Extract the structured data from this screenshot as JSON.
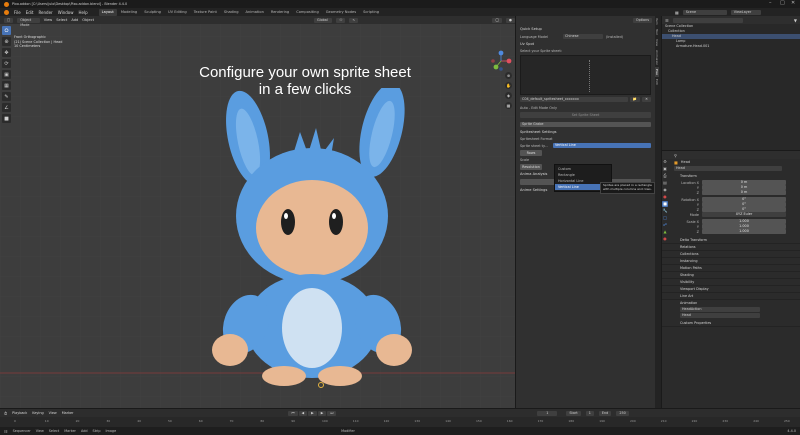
{
  "window": {
    "title": "Pixo.addon [C:\\Users\\julo\\Desktop\\Pixo.addon.blend] - Blender 4.4.0",
    "controls": [
      "–",
      "□",
      "✕"
    ]
  },
  "menubar": {
    "items": [
      "File",
      "Edit",
      "Render",
      "Window",
      "Help"
    ],
    "workspaces": [
      "Layout",
      "Modeling",
      "Sculpting",
      "UV Editing",
      "Texture Paint",
      "Shading",
      "Animation",
      "Rendering",
      "Compositing",
      "Geometry Nodes",
      "Scripting"
    ],
    "active_workspace": "Layout",
    "scene_label": "Scene",
    "view_layer_label": "ViewLayer"
  },
  "viewport": {
    "mode": "Object Mode",
    "menus": [
      "View",
      "Select",
      "Add",
      "Object"
    ],
    "transform": "Global",
    "options_label": "Options",
    "overlay_lines": [
      "Front Orthographic",
      "(21) Scene Collection | Head",
      "10 Centimeters"
    ],
    "headline_line1": "Configure your own sprite sheet",
    "headline_line2": "in a few clicks",
    "gizmo_axes": [
      "X",
      "Y",
      "Z"
    ]
  },
  "npanel": {
    "quick_setup": "Quick Setup",
    "language_model_label": "Language Model",
    "language_model_value": "Chinese",
    "installed_label": "(Installed)",
    "uv_spot": "Uv Spot",
    "select_sprite_sheet": "Select your Sprite sheet:",
    "file_name": "C04_default_spritesheet_xxxxxxx",
    "auto_edit_label": "Auto - Edit Mode Only",
    "set_button": "Set Sprite Sheet",
    "sprite_dropdown": "Sprite Grabe",
    "spritesheet_settings": "Spritesheet Settings",
    "spritesheet_format": "Spritesheet Format",
    "sprite_sheet_ty_label": "Sprite sheet ty...",
    "sprite_sheet_ty_value": "Vertical Line",
    "rows_label": "Rows",
    "scale_label": "Scale",
    "resolution_label": "Resolution",
    "count_label": "Count",
    "dropdown_options": [
      "Custom",
      "Rectangle",
      "Horizontal Line",
      "Vertical Line"
    ],
    "dropdown_selected": "Vertical Line",
    "tooltip": "Sprites are placed in a rectangle with multiple columns and rows.",
    "anima_analysis": "Anima Analysis",
    "analyze_button": "Analyze audio",
    "anime_settings": "Anime Settings"
  },
  "side_tabs": [
    "Item",
    "Tool",
    "View",
    "Animation",
    "Pixo",
    "Edit"
  ],
  "outliner": {
    "search_placeholder": "",
    "root": "Scene Collection",
    "rows": [
      "Collection",
      "Head",
      "Lamp",
      "Armature.Head.001"
    ],
    "selected": "Head"
  },
  "properties": {
    "object_name": "Head",
    "data_name": "Head",
    "transform_label": "Transform",
    "location_label": "Location X",
    "y_label": "Y",
    "z_label": "Z",
    "rotation_label": "Rotation X",
    "mode_label": "Mode",
    "mode_value": "XYZ Euler",
    "scale_label": "Scale X",
    "location_values": [
      "0 m",
      "0 m",
      "0 m"
    ],
    "rotation_values": [
      "0°",
      "0°",
      "0°"
    ],
    "scale_values": [
      "1.000",
      "1.000",
      "1.000"
    ],
    "sections": [
      "Delta Transform",
      "Relations",
      "Collections",
      "Instancing",
      "Motion Paths",
      "Shading",
      "Visibility",
      "Viewport Display",
      "Line Art"
    ],
    "animation_label": "Animation",
    "anim_rows": [
      "HeadAction",
      "Head"
    ],
    "custom_properties": "Custom Properties"
  },
  "timeline": {
    "menus": [
      "Playback",
      "Keying",
      "View",
      "Marker"
    ],
    "current_frame": "1",
    "start_label": "Start",
    "start_value": "1",
    "end_label": "End",
    "end_value": "250",
    "ticks": [
      "0",
      "10",
      "20",
      "30",
      "40",
      "50",
      "60",
      "70",
      "80",
      "90",
      "100",
      "110",
      "120",
      "130",
      "140",
      "150",
      "160",
      "170",
      "180",
      "190",
      "200",
      "210",
      "220",
      "230",
      "240",
      "250"
    ]
  },
  "statusbar": {
    "editor": "Sequencer",
    "menus": [
      "View",
      "Select",
      "Marker",
      "Add",
      "Strip",
      "Image"
    ],
    "mode": "Modifier",
    "version": "4.4.0"
  },
  "colors": {
    "accent": "#4773b6",
    "mascot_blue": "#5a9de0",
    "mascot_skin": "#e8b893"
  }
}
